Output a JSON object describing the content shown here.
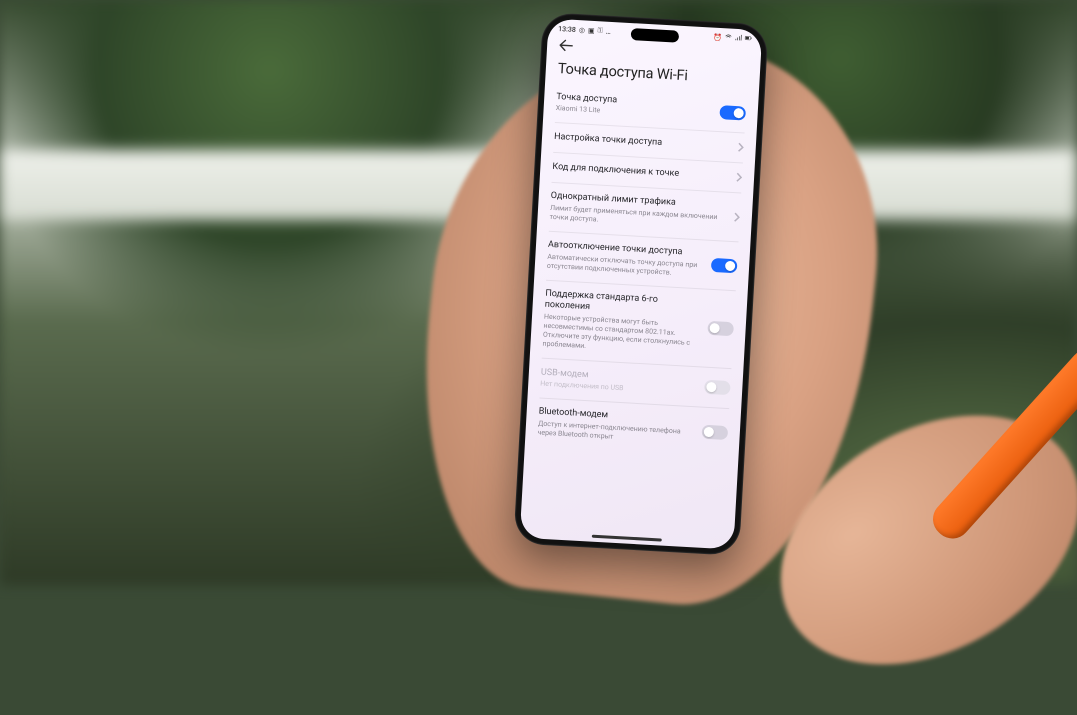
{
  "statusbar": {
    "time": "13:38",
    "left_icons": [
      "clock",
      "square",
      "key",
      "more"
    ],
    "right_icons": [
      "alarm",
      "wifi",
      "signal",
      "battery"
    ]
  },
  "header": {
    "title": "Точка доступа Wi-Fi"
  },
  "rows": [
    {
      "key": "hotspot",
      "label": "Точка доступа",
      "sub": "Xiaomi 13 Lite",
      "control": "toggle",
      "on": true
    },
    {
      "key": "setup",
      "label": "Настройка точки доступа",
      "control": "chevron"
    },
    {
      "key": "code",
      "label": "Код для подключения к точке",
      "control": "chevron"
    },
    {
      "key": "limit",
      "label": "Однократный лимит трафика",
      "sub": "Лимит будет применяться при каждом включении точки доступа.",
      "control": "chevron"
    },
    {
      "key": "autooff",
      "label": "Автоотключение точки доступа",
      "sub": "Автоматически отключать точку доступа при отсутствии подключенных устройств.",
      "control": "toggle",
      "on": true
    },
    {
      "key": "wifi6",
      "label": "Поддержка стандарта 6-го поколения",
      "sub": "Некоторые устройства могут быть несовместимы со стандартом 802.11ax. Отключите эту функцию, если столкнулись с проблемами.",
      "control": "toggle",
      "on": false
    },
    {
      "key": "usb",
      "label": "USB-модем",
      "sub": "Нет подключения по USB",
      "control": "toggle",
      "on": false,
      "disabled": true
    },
    {
      "key": "bt",
      "label": "Bluetooth-модем",
      "sub": "Доступ к интернет-подключению телефона через Bluetooth открыт",
      "control": "toggle",
      "on": false
    }
  ]
}
